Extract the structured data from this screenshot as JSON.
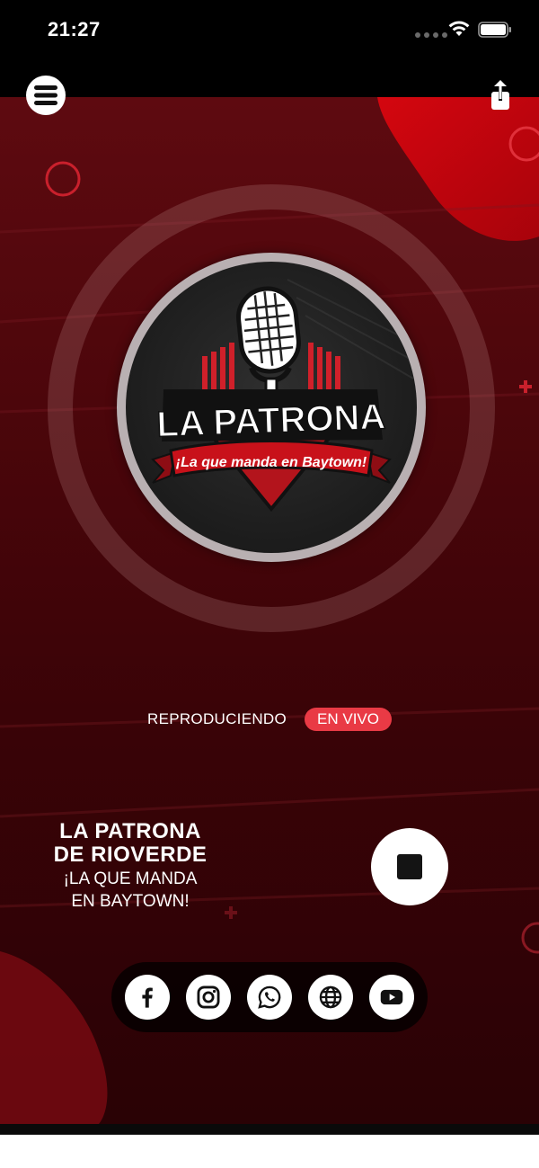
{
  "status_bar": {
    "time": "21:27"
  },
  "logo": {
    "title": "LA PATRONA",
    "slogan": "¡La que manda en Baytown!"
  },
  "player": {
    "now_playing_label": "REPRODUCIENDO",
    "live_badge": "EN VIVO",
    "station_name_line1": "LA PATRONA",
    "station_name_line2": "DE RIOVERDE",
    "slogan_line1": "¡LA QUE MANDA",
    "slogan_line2": "EN BAYTOWN!"
  },
  "social": [
    {
      "icon": "facebook-icon"
    },
    {
      "icon": "instagram-icon"
    },
    {
      "icon": "whatsapp-icon"
    },
    {
      "icon": "globe-icon"
    },
    {
      "icon": "youtube-icon"
    }
  ],
  "colors": {
    "accent": "#e93a45",
    "background_dark": "#3a0307",
    "background_red": "#c8050f"
  }
}
